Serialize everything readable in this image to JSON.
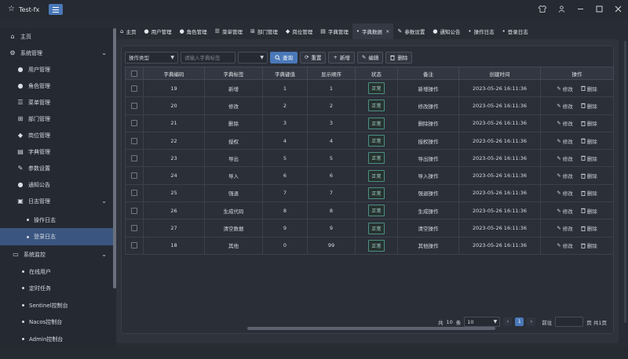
{
  "app": {
    "title": "Test-fx"
  },
  "sidebar": {
    "items": [
      {
        "label": "主页",
        "icon": "home-icon"
      },
      {
        "label": "系统管理",
        "icon": "gear-icon"
      },
      {
        "label": "用户管理",
        "icon": "user-icon"
      },
      {
        "label": "角色管理",
        "icon": "users-icon"
      },
      {
        "label": "菜单管理",
        "icon": "menu-list-icon"
      },
      {
        "label": "部门管理",
        "icon": "org-chart-icon"
      },
      {
        "label": "岗位管理",
        "icon": "post-icon"
      },
      {
        "label": "字典管理",
        "icon": "book-icon"
      },
      {
        "label": "参数设置",
        "icon": "edit-icon"
      },
      {
        "label": "通知公告",
        "icon": "chat-icon"
      },
      {
        "label": "日志管理",
        "icon": "log-icon"
      },
      {
        "label": "操作日志"
      },
      {
        "label": "登录日志"
      },
      {
        "label": "系统监控",
        "icon": "monitor-icon"
      },
      {
        "label": "在线用户"
      },
      {
        "label": "定时任务"
      },
      {
        "label": "Sentinel控制台"
      },
      {
        "label": "Nacos控制台"
      },
      {
        "label": "Admin控制台"
      }
    ]
  },
  "tabs": [
    {
      "label": "主页",
      "icon": "home-icon"
    },
    {
      "label": "用户管理",
      "icon": "user-icon"
    },
    {
      "label": "角色管理",
      "icon": "users-icon"
    },
    {
      "label": "菜单管理",
      "icon": "menu-list-icon"
    },
    {
      "label": "部门管理",
      "icon": "org-chart-icon"
    },
    {
      "label": "岗位管理",
      "icon": "post-icon"
    },
    {
      "label": "字典管理",
      "icon": "book-icon"
    },
    {
      "label": "字典数据",
      "icon": "dot-icon"
    },
    {
      "label": "参数设置",
      "icon": "edit-icon"
    },
    {
      "label": "通知公告",
      "icon": "chat-icon"
    },
    {
      "label": "操作日志",
      "icon": "dot-icon"
    },
    {
      "label": "登录日志",
      "icon": "dot-icon"
    }
  ],
  "toolbar": {
    "dict_type": "操作类型",
    "label_placeholder": "请输入字典标签",
    "search": "查询",
    "reset": "重置",
    "add": "新增",
    "edit": "编辑",
    "delete": "删除"
  },
  "table": {
    "columns": [
      "字典编码",
      "字典标签",
      "字典键值",
      "显示顺序",
      "状态",
      "备注",
      "创建时间",
      "操作"
    ],
    "rows": [
      {
        "code": "19",
        "label": "新增",
        "value": "1",
        "order": "1",
        "status": "正常",
        "remark": "新增操作",
        "created": "2023-05-26 16:11:36"
      },
      {
        "code": "20",
        "label": "修改",
        "value": "2",
        "order": "2",
        "status": "正常",
        "remark": "修改操作",
        "created": "2023-05-26 16:11:36"
      },
      {
        "code": "21",
        "label": "删除",
        "value": "3",
        "order": "3",
        "status": "正常",
        "remark": "删除操作",
        "created": "2023-05-26 16:11:36"
      },
      {
        "code": "22",
        "label": "授权",
        "value": "4",
        "order": "4",
        "status": "正常",
        "remark": "授权操作",
        "created": "2023-05-26 16:11:36"
      },
      {
        "code": "23",
        "label": "导出",
        "value": "5",
        "order": "5",
        "status": "正常",
        "remark": "导出操作",
        "created": "2023-05-26 16:11:36"
      },
      {
        "code": "24",
        "label": "导入",
        "value": "6",
        "order": "6",
        "status": "正常",
        "remark": "导入操作",
        "created": "2023-05-26 16:11:36"
      },
      {
        "code": "25",
        "label": "强退",
        "value": "7",
        "order": "7",
        "status": "正常",
        "remark": "强退操作",
        "created": "2023-05-26 16:11:36"
      },
      {
        "code": "26",
        "label": "生成代码",
        "value": "8",
        "order": "8",
        "status": "正常",
        "remark": "生成操作",
        "created": "2023-05-26 16:11:36"
      },
      {
        "code": "27",
        "label": "清空数据",
        "value": "9",
        "order": "9",
        "status": "正常",
        "remark": "清空操作",
        "created": "2023-05-26 16:11:36"
      },
      {
        "code": "18",
        "label": "其他",
        "value": "0",
        "order": "99",
        "status": "正常",
        "remark": "其他操作",
        "created": "2023-05-26 16:11:36"
      }
    ],
    "edit_label": "修改",
    "delete_label": "删除"
  },
  "pager": {
    "total_prefix": "共",
    "total": "10",
    "total_suffix": "条",
    "page_size": "10",
    "current_page": "1",
    "goto_label": "前往",
    "pages_text": "页 共1页"
  },
  "colors": {
    "accent": "#4a78b8",
    "status_border": "#4c8f86"
  }
}
